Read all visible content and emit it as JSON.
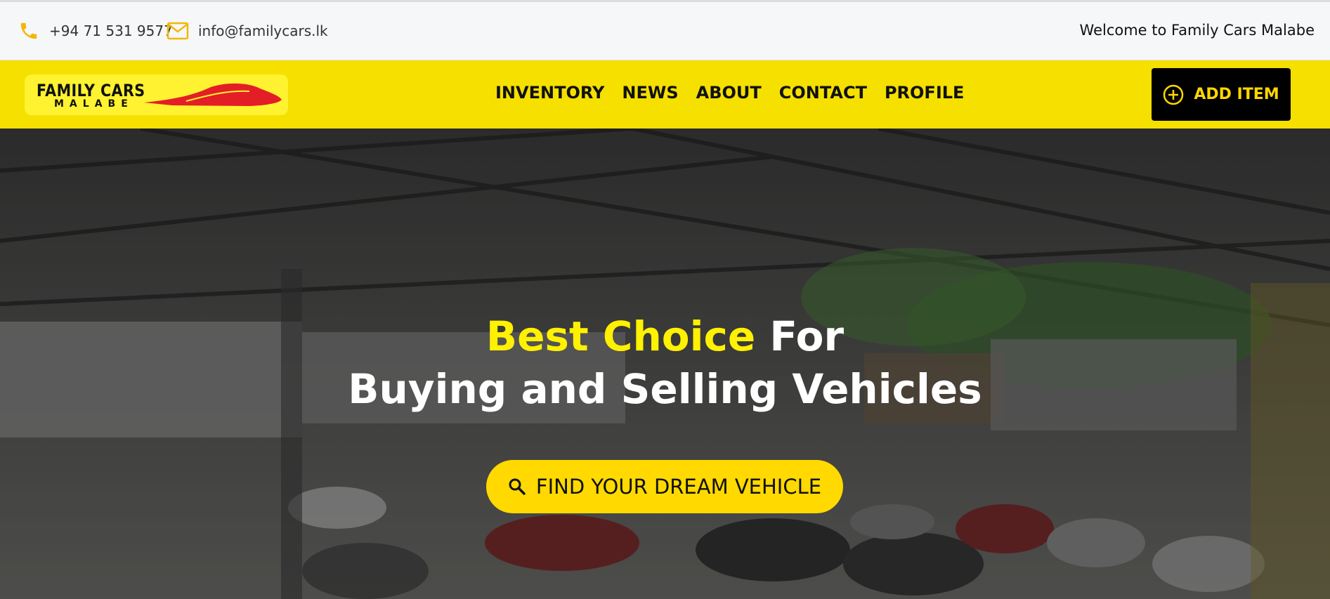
{
  "topbar": {
    "phone": "+94 71 531 9577",
    "phone_icon": "phone-icon",
    "email": "info@familycars.lk",
    "email_icon": "mail-icon",
    "welcome": "Welcome to Family Cars Malabe"
  },
  "logo": {
    "line1": "FAMILY CARS",
    "line2": "MALABE"
  },
  "nav": {
    "items": [
      {
        "label": "INVENTORY"
      },
      {
        "label": "NEWS"
      },
      {
        "label": "ABOUT"
      },
      {
        "label": "CONTACT"
      },
      {
        "label": "PROFILE"
      }
    ]
  },
  "add_button": {
    "label": "ADD ITEM",
    "icon": "plus-circle-icon"
  },
  "hero": {
    "title_highlight": "Best Choice",
    "title_rest": " For",
    "subtitle": "Buying and Selling Vehicles",
    "cta_label": "FIND YOUR DREAM VEHICLE",
    "cta_icon": "search-icon"
  },
  "colors": {
    "brand_yellow": "#f5e000",
    "accent_yellow": "#ffd900",
    "highlight_text": "#fff100",
    "dark": "#000000"
  }
}
